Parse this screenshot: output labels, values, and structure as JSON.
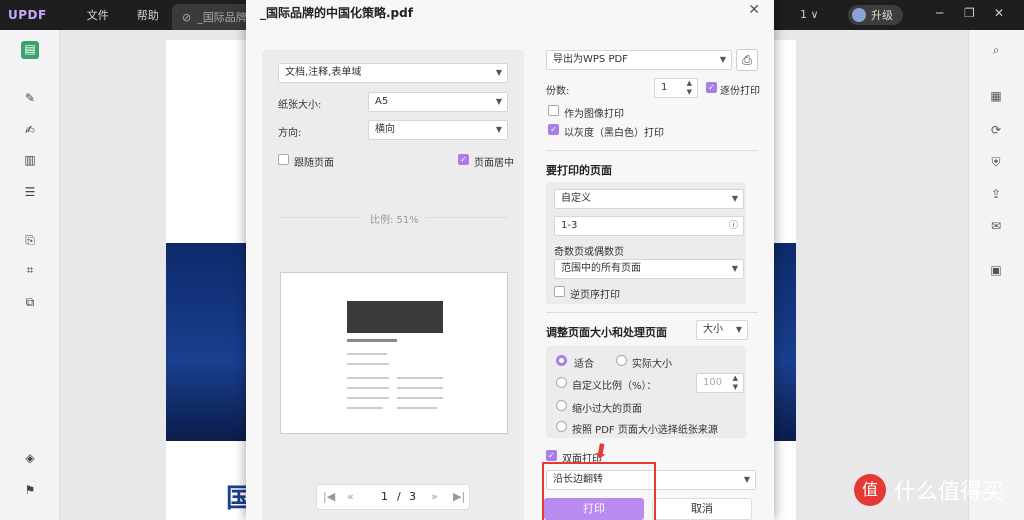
{
  "app": {
    "logo": "UPDF",
    "menu": [
      "文件",
      "帮助"
    ],
    "tab_title": "_国际品牌",
    "page_count": "1 ∨",
    "upgrade_label": "升级"
  },
  "dialog": {
    "title": "_国际品牌的中国化策略.pdf",
    "left": {
      "content_select": "文档,注释,表单域",
      "paper_size_label": "纸张大小:",
      "paper_size_value": "A5",
      "orientation_label": "方向:",
      "orientation_value": "横向",
      "follow_page_label": "跟随页面",
      "center_page_label": "页面居中",
      "scale_label": "比例: 51%",
      "pager_current": "1",
      "pager_separator": "/",
      "pager_total": "3"
    },
    "right": {
      "printer": "导出为WPS PDF",
      "copies_label": "份数:",
      "copies_value": "1",
      "collate_label": "逐份打印",
      "as_image_label": "作为图像打印",
      "grayscale_label": "以灰度（黑白色）打印",
      "pages_section": "要打印的页面",
      "pages_mode": "自定义",
      "pages_range": "1-3",
      "odd_even_label": "奇数页或偶数页",
      "odd_even_value": "范围中的所有页面",
      "reverse_label": "逆页序打印",
      "size_section": "调整页面大小和处理页面",
      "size_mode": "大小",
      "fit_label": "适合",
      "actual_size_label": "实际大小",
      "custom_scale_label": "自定义比例（%）：",
      "custom_scale_value": "100",
      "shrink_label": "缩小过大的页面",
      "pdf_page_size_label": "按照 PDF 页面大小选择纸张来源",
      "duplex_label": "双面打印",
      "flip_value": "沿长边翻转",
      "print_button": "打印",
      "cancel_button": "取消"
    }
  },
  "watermark": {
    "icon_text": "值",
    "text": "什么值得买"
  }
}
